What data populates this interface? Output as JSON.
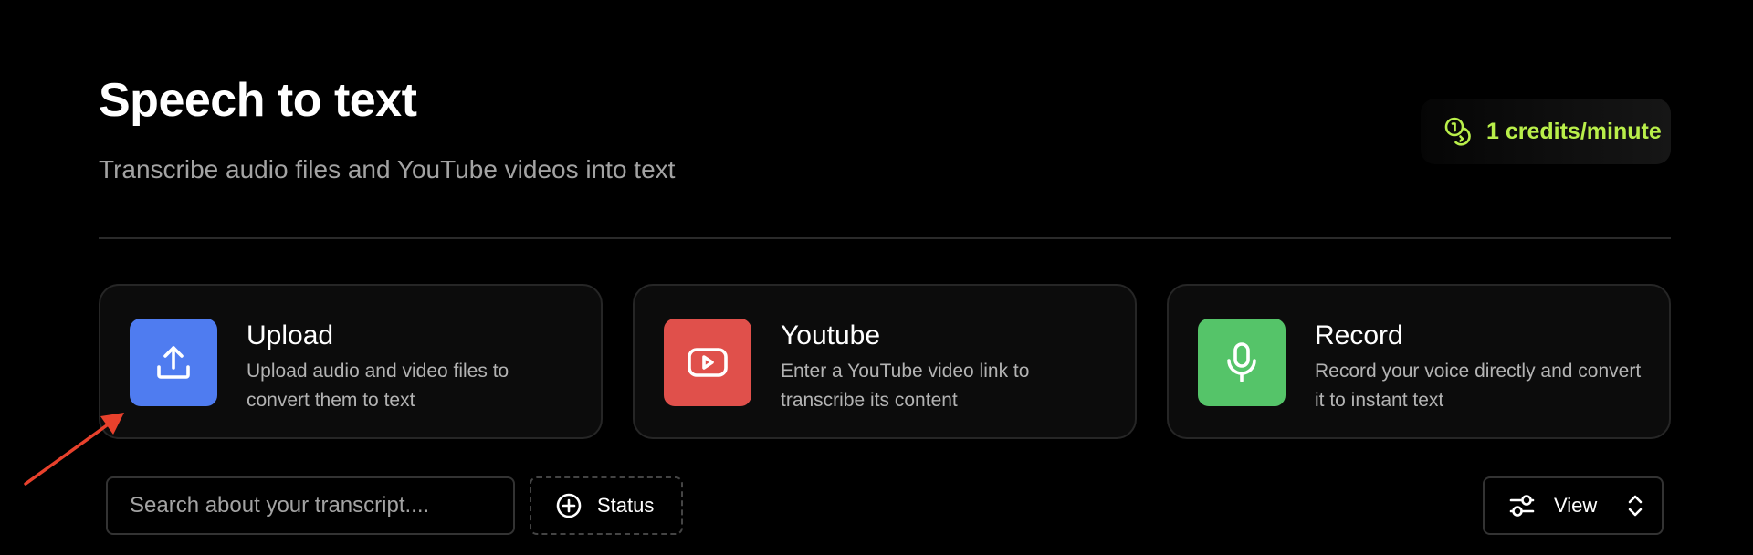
{
  "header": {
    "title": "Speech to text",
    "subtitle": "Transcribe audio files and YouTube videos into text"
  },
  "credits": {
    "label": "1 credits/minute",
    "icon": "coins-icon",
    "color": "#b9ef4a"
  },
  "cards": [
    {
      "title": "Upload",
      "description": "Upload audio and video files to convert them to text",
      "icon": "upload-icon",
      "color": "#4f7cf0"
    },
    {
      "title": "Youtube",
      "description": "Enter a YouTube video link to transcribe its content",
      "icon": "youtube-play-icon",
      "color": "#e0504b"
    },
    {
      "title": "Record",
      "description": "Record your voice directly and convert it to instant text",
      "icon": "microphone-icon",
      "color": "#55c469"
    }
  ],
  "toolbar": {
    "search_placeholder": "Search about your transcript....",
    "status_label": "Status",
    "view_label": "View"
  },
  "annotation": {
    "arrow_color": "#e8412c"
  }
}
